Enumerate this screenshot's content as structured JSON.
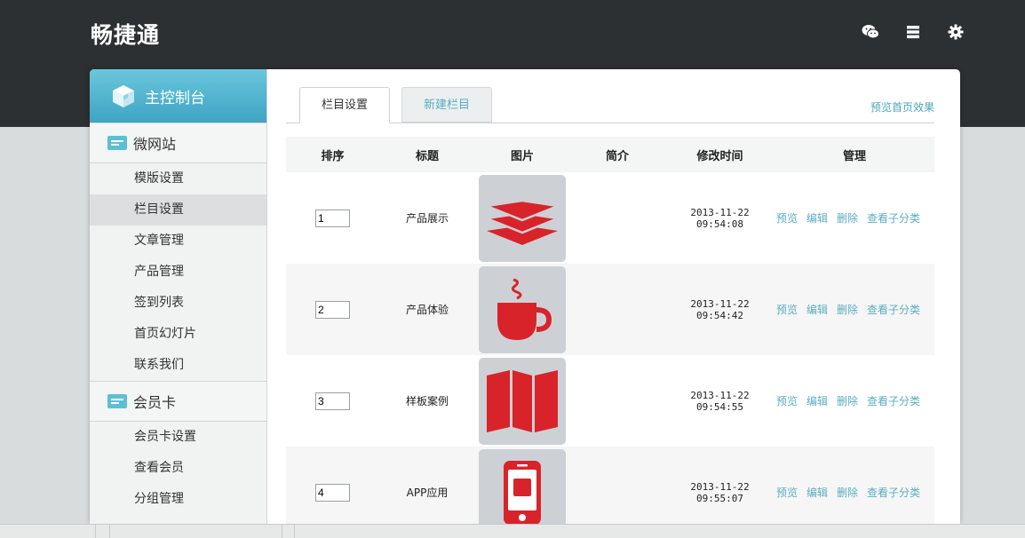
{
  "app": {
    "title": "畅捷通"
  },
  "top_icons": [
    "wechat-icon",
    "menu-list-icon",
    "gear-icon"
  ],
  "sidebar": {
    "console_label": "主控制台",
    "groups": [
      {
        "title": "微网站",
        "items": [
          "模版设置",
          "栏目设置",
          "文章管理",
          "产品管理",
          "签到列表",
          "首页幻灯片",
          "联系我们"
        ]
      },
      {
        "title": "会员卡",
        "items": [
          "会员卡设置",
          "查看会员",
          "分组管理"
        ]
      }
    ],
    "active_item": "栏目设置"
  },
  "tabs": {
    "active": "栏目设置",
    "inactive": "新建栏目"
  },
  "preview_home": "预览首页效果",
  "table": {
    "headers": [
      "排序",
      "标题",
      "图片",
      "简介",
      "修改时间",
      "管理"
    ],
    "rows": [
      {
        "order": "1",
        "title": "产品展示",
        "icon": "layers-icon",
        "intro": "",
        "time": "2013-11-22 09:54:08"
      },
      {
        "order": "2",
        "title": "产品体验",
        "icon": "coffee-cup-icon",
        "intro": "",
        "time": "2013-11-22 09:54:42"
      },
      {
        "order": "3",
        "title": "样板案例",
        "icon": "folded-map-icon",
        "intro": "",
        "time": "2013-11-22 09:54:55"
      },
      {
        "order": "4",
        "title": "APP应用",
        "icon": "mobile-phone-icon",
        "intro": "",
        "time": "2013-11-22 09:55:07"
      }
    ],
    "actions": [
      "预览",
      "编辑",
      "删除",
      "查看子分类"
    ]
  },
  "colors": {
    "header_bg": "#2c3033",
    "accent": "#5aaec2",
    "icon_red": "#d9232a",
    "thumb_bg": "#cdd1d5"
  }
}
